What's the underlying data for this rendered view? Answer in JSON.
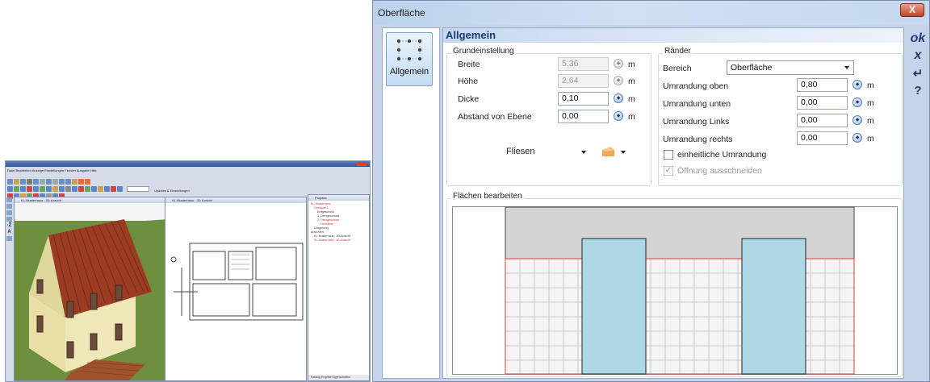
{
  "dialog": {
    "title": "Oberfläche",
    "close_glyph": "X",
    "sidebar": {
      "item_label": "Allgemein",
      "item_icon": "grid-points-icon"
    },
    "header": "Allgemein",
    "grundeinstellung": {
      "title": "Grundeinstellung",
      "breite": {
        "label": "Breite",
        "value": "5,36",
        "unit": "m"
      },
      "hoehe": {
        "label": "Höhe",
        "value": "2,64",
        "unit": "m"
      },
      "dicke": {
        "label": "Dicke",
        "value": "0,10",
        "unit": "m"
      },
      "abstand": {
        "label": "Abstand von Ebene",
        "value": "0,00",
        "unit": "m"
      },
      "material": "Fliesen"
    },
    "raender": {
      "title": "Ränder",
      "bereich": {
        "label": "Bereich",
        "value": "Oberfläche"
      },
      "oben": {
        "label": "Umrandung oben",
        "value": "0,80",
        "unit": "m"
      },
      "unten": {
        "label": "Umrandung unten",
        "value": "0,00",
        "unit": "m"
      },
      "links": {
        "label": "Umrandung Links",
        "value": "0,00",
        "unit": "m"
      },
      "rechts": {
        "label": "Umrandung rechts",
        "value": "0,00",
        "unit": "m"
      },
      "einheitlich": {
        "label": "einheitliche Umrandung",
        "checked": false
      },
      "oeffnung": {
        "label": "Öffnung ausschneiden",
        "checked": true
      }
    },
    "flaechen": {
      "title": "Flächen bearbeiten"
    },
    "right_toolbar": {
      "ok": "ok",
      "cancel": "x",
      "apply": "↵",
      "help": "?"
    }
  },
  "colors": {
    "window_tile": "#add8e6",
    "wall_grey": "#d4d4d4",
    "border_red": "#e03a3a",
    "tile_grid": "#c8c8c8",
    "roof": "#9b3b22",
    "wall_house": "#efe7b8",
    "lawn": "#6e8f3e",
    "terrace": "#a0522d"
  },
  "thumbnail": {
    "menu": "Datei  Bearbeiten  Anzeige  Einstellungen  Fenster  Ausgabe  Hilfe",
    "update_label": "Updates & Einstellungen",
    "pane3d_title": "KL-Musterhaus : 3D-Ansicht",
    "pane2d_title": "KL-Musterhaus : 2D-Ansicht",
    "project_title": "Projekte",
    "tree": [
      "KL-Musterhaus",
      "Gebäude 1",
      "Erdgeschoss",
      "1. Obergeschoss",
      "2. Obergeschoss",
      "Grundriss",
      "Umgebung",
      "Ansichten",
      "KL-Musterhaus : 2D-Ansicht",
      "KL-Musterhaus : 3D-Ansicht"
    ],
    "tabs": "Katalog   Projekte   Eigenschaften"
  }
}
